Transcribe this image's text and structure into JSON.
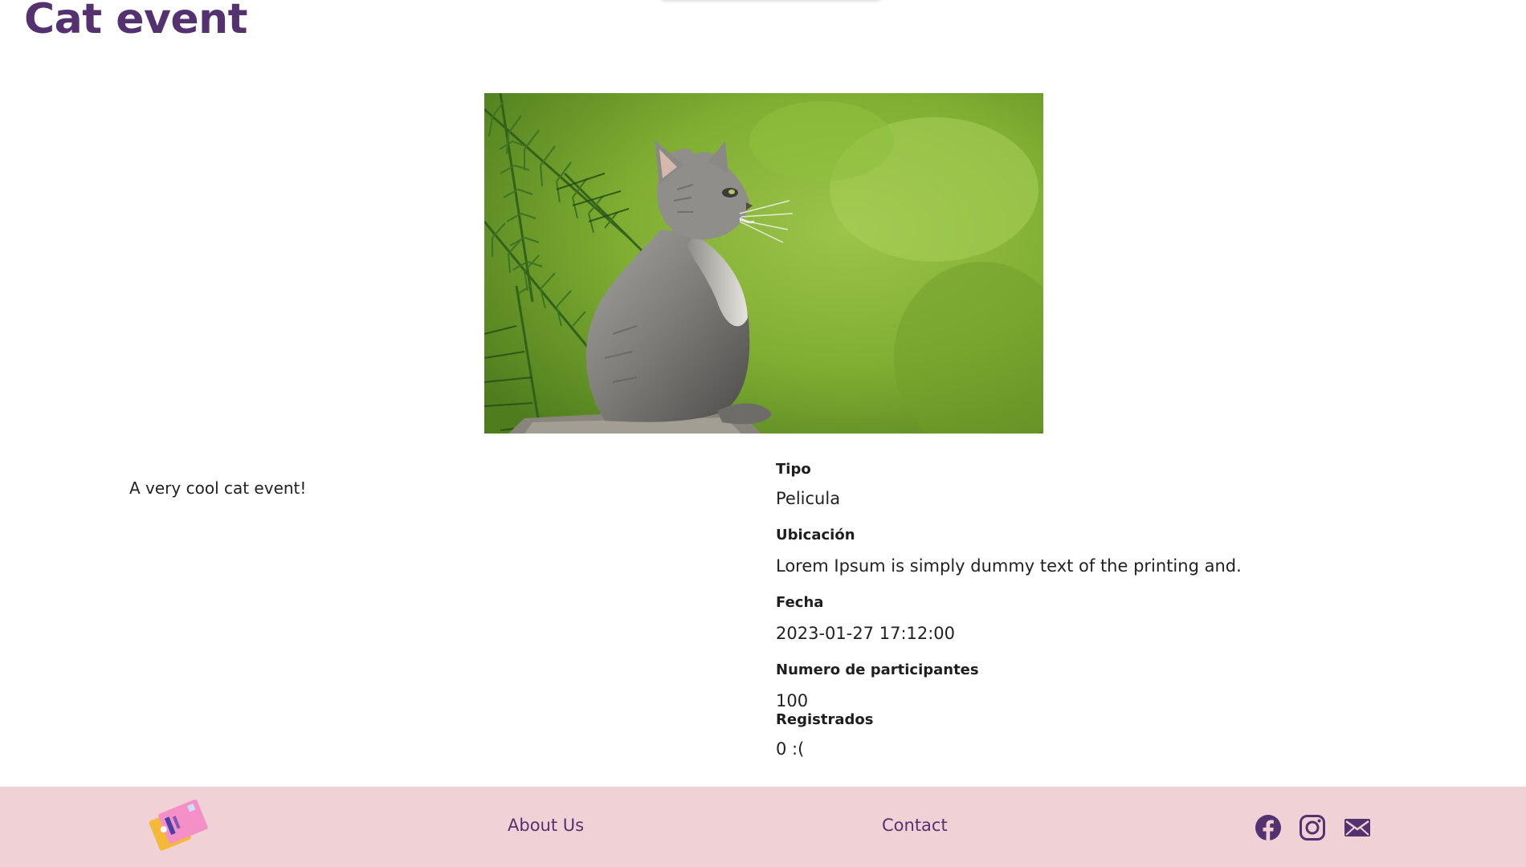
{
  "page": {
    "title": "Cat event"
  },
  "event": {
    "image_alt": "Gray kitten sitting among green pine branches",
    "description": "A very cool cat event!",
    "details": [
      {
        "label": "Tipo",
        "value": "Pelicula"
      },
      {
        "label": "Ubicación",
        "value": "Lorem Ipsum is simply dummy text of the printing and."
      },
      {
        "label": "Fecha",
        "value": "2023-01-27 17:12:00"
      },
      {
        "label": "Numero de participantes",
        "value": "100"
      },
      {
        "label": "Registrados",
        "value": "0 :("
      }
    ]
  },
  "footer": {
    "about_label": "About Us",
    "contact_label": "Contact",
    "social": [
      "facebook-icon",
      "instagram-icon",
      "mail-icon"
    ]
  },
  "colors": {
    "title": "#53326f",
    "footer_bg": "#f0d2d6",
    "footer_link": "#53326f"
  }
}
